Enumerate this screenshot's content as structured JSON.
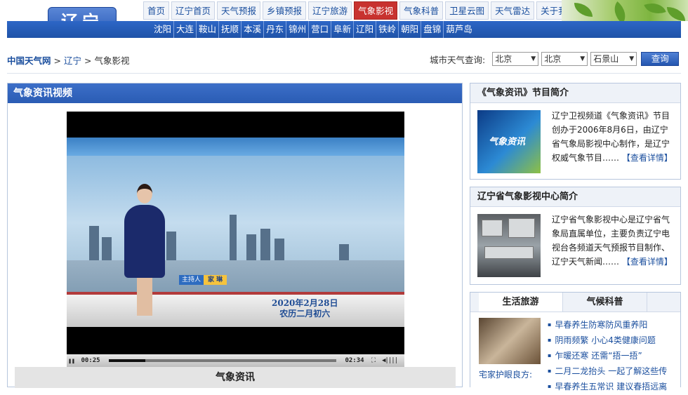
{
  "header": {
    "logo": "辽宁",
    "nav": [
      "首页",
      "辽宁首页",
      "天气预报",
      "乡镇预报",
      "辽宁旅游",
      "气象影视",
      "气象科普",
      "卫星云图",
      "天气雷达",
      "关于我们"
    ],
    "active_nav": "气象影视",
    "cities": [
      "沈阳",
      "大连",
      "鞍山",
      "抚顺",
      "本溪",
      "丹东",
      "锦州",
      "营口",
      "阜新",
      "辽阳",
      "铁岭",
      "朝阳",
      "盘锦",
      "葫芦岛"
    ]
  },
  "breadcrumb": {
    "home": "中国天气网",
    "sep": ">",
    "level1": "辽宁",
    "current": "气象影视"
  },
  "city_query": {
    "label": "城市天气查询:",
    "province": "北京",
    "city": "北京",
    "district": "石景山",
    "button": "查询"
  },
  "video_panel": {
    "title": "气象资讯视频",
    "host_role": "主持人",
    "host_name": "家 琳",
    "date_line1": "2020年2月28日",
    "date_line2": "农历二月初六",
    "time_current": "00:25",
    "time_total": "02:34",
    "progress": 0.16,
    "caption": "气象资讯"
  },
  "program_intro": {
    "title": "《气象资讯》节目简介",
    "thumb_text": "气象资讯",
    "text": "辽宁卫视频道《气象资讯》节目创办于2006年8月6日，由辽宁省气象局影视中心制作，是辽宁权威气象节目……",
    "more": "【查看详情】"
  },
  "center_intro": {
    "title": "辽宁省气象影视中心简介",
    "text": "辽宁省气象影视中心是辽宁省气象局直属单位，主要负责辽宁电视台各频道天气预报节目制作、辽宁天气新闻……",
    "more": "【查看详情】"
  },
  "tabs_box": {
    "tabs": [
      "生活旅游",
      "气候科普"
    ],
    "active": "生活旅游",
    "image_caption": "宅家护眼良方:",
    "items": [
      "早春养生防寒防风重养阳",
      "阴雨频繁 小心4类健康问题",
      "乍暖还寒 还需“捂一捂”",
      "二月二龙抬头 一起了解这些传",
      "早春养生五常识 建议春捂远离"
    ]
  },
  "colors": {
    "brand_blue": "#2a5cb4",
    "active_red": "#c8322f",
    "link_blue": "#1b4f9e"
  }
}
